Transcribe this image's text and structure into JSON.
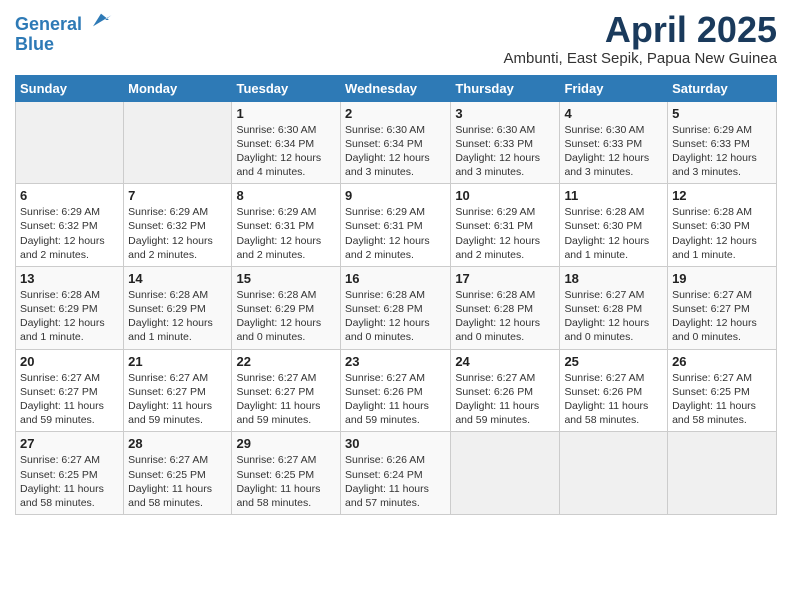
{
  "logo": {
    "line1": "General",
    "line2": "Blue"
  },
  "title": "April 2025",
  "subtitle": "Ambunti, East Sepik, Papua New Guinea",
  "days_of_week": [
    "Sunday",
    "Monday",
    "Tuesday",
    "Wednesday",
    "Thursday",
    "Friday",
    "Saturday"
  ],
  "weeks": [
    [
      {
        "day": "",
        "info": ""
      },
      {
        "day": "",
        "info": ""
      },
      {
        "day": "1",
        "info": "Sunrise: 6:30 AM\nSunset: 6:34 PM\nDaylight: 12 hours and 4 minutes."
      },
      {
        "day": "2",
        "info": "Sunrise: 6:30 AM\nSunset: 6:34 PM\nDaylight: 12 hours and 3 minutes."
      },
      {
        "day": "3",
        "info": "Sunrise: 6:30 AM\nSunset: 6:33 PM\nDaylight: 12 hours and 3 minutes."
      },
      {
        "day": "4",
        "info": "Sunrise: 6:30 AM\nSunset: 6:33 PM\nDaylight: 12 hours and 3 minutes."
      },
      {
        "day": "5",
        "info": "Sunrise: 6:29 AM\nSunset: 6:33 PM\nDaylight: 12 hours and 3 minutes."
      }
    ],
    [
      {
        "day": "6",
        "info": "Sunrise: 6:29 AM\nSunset: 6:32 PM\nDaylight: 12 hours and 2 minutes."
      },
      {
        "day": "7",
        "info": "Sunrise: 6:29 AM\nSunset: 6:32 PM\nDaylight: 12 hours and 2 minutes."
      },
      {
        "day": "8",
        "info": "Sunrise: 6:29 AM\nSunset: 6:31 PM\nDaylight: 12 hours and 2 minutes."
      },
      {
        "day": "9",
        "info": "Sunrise: 6:29 AM\nSunset: 6:31 PM\nDaylight: 12 hours and 2 minutes."
      },
      {
        "day": "10",
        "info": "Sunrise: 6:29 AM\nSunset: 6:31 PM\nDaylight: 12 hours and 2 minutes."
      },
      {
        "day": "11",
        "info": "Sunrise: 6:28 AM\nSunset: 6:30 PM\nDaylight: 12 hours and 1 minute."
      },
      {
        "day": "12",
        "info": "Sunrise: 6:28 AM\nSunset: 6:30 PM\nDaylight: 12 hours and 1 minute."
      }
    ],
    [
      {
        "day": "13",
        "info": "Sunrise: 6:28 AM\nSunset: 6:29 PM\nDaylight: 12 hours and 1 minute."
      },
      {
        "day": "14",
        "info": "Sunrise: 6:28 AM\nSunset: 6:29 PM\nDaylight: 12 hours and 1 minute."
      },
      {
        "day": "15",
        "info": "Sunrise: 6:28 AM\nSunset: 6:29 PM\nDaylight: 12 hours and 0 minutes."
      },
      {
        "day": "16",
        "info": "Sunrise: 6:28 AM\nSunset: 6:28 PM\nDaylight: 12 hours and 0 minutes."
      },
      {
        "day": "17",
        "info": "Sunrise: 6:28 AM\nSunset: 6:28 PM\nDaylight: 12 hours and 0 minutes."
      },
      {
        "day": "18",
        "info": "Sunrise: 6:27 AM\nSunset: 6:28 PM\nDaylight: 12 hours and 0 minutes."
      },
      {
        "day": "19",
        "info": "Sunrise: 6:27 AM\nSunset: 6:27 PM\nDaylight: 12 hours and 0 minutes."
      }
    ],
    [
      {
        "day": "20",
        "info": "Sunrise: 6:27 AM\nSunset: 6:27 PM\nDaylight: 11 hours and 59 minutes."
      },
      {
        "day": "21",
        "info": "Sunrise: 6:27 AM\nSunset: 6:27 PM\nDaylight: 11 hours and 59 minutes."
      },
      {
        "day": "22",
        "info": "Sunrise: 6:27 AM\nSunset: 6:27 PM\nDaylight: 11 hours and 59 minutes."
      },
      {
        "day": "23",
        "info": "Sunrise: 6:27 AM\nSunset: 6:26 PM\nDaylight: 11 hours and 59 minutes."
      },
      {
        "day": "24",
        "info": "Sunrise: 6:27 AM\nSunset: 6:26 PM\nDaylight: 11 hours and 59 minutes."
      },
      {
        "day": "25",
        "info": "Sunrise: 6:27 AM\nSunset: 6:26 PM\nDaylight: 11 hours and 58 minutes."
      },
      {
        "day": "26",
        "info": "Sunrise: 6:27 AM\nSunset: 6:25 PM\nDaylight: 11 hours and 58 minutes."
      }
    ],
    [
      {
        "day": "27",
        "info": "Sunrise: 6:27 AM\nSunset: 6:25 PM\nDaylight: 11 hours and 58 minutes."
      },
      {
        "day": "28",
        "info": "Sunrise: 6:27 AM\nSunset: 6:25 PM\nDaylight: 11 hours and 58 minutes."
      },
      {
        "day": "29",
        "info": "Sunrise: 6:27 AM\nSunset: 6:25 PM\nDaylight: 11 hours and 58 minutes."
      },
      {
        "day": "30",
        "info": "Sunrise: 6:26 AM\nSunset: 6:24 PM\nDaylight: 11 hours and 57 minutes."
      },
      {
        "day": "",
        "info": ""
      },
      {
        "day": "",
        "info": ""
      },
      {
        "day": "",
        "info": ""
      }
    ]
  ]
}
